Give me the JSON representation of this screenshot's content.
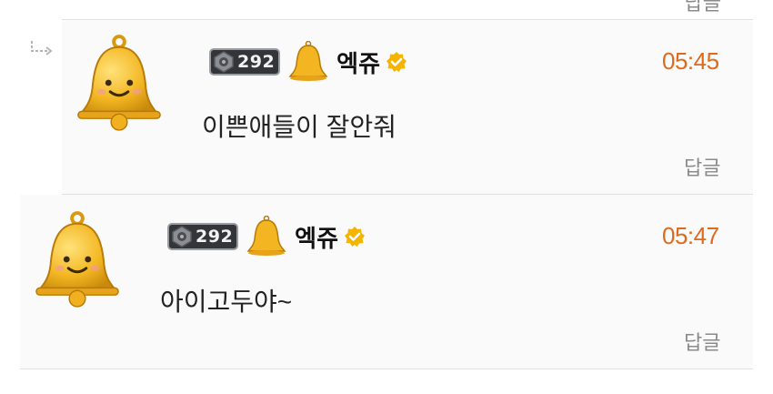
{
  "thread": {
    "prev_reply_label": "답글",
    "comments": [
      {
        "type": "reply",
        "level": "292",
        "nickname": "엑쥬",
        "time": "05:45",
        "text": "이쁜애들이 잘안줘",
        "reply_label": "답글"
      },
      {
        "type": "comment",
        "level": "292",
        "nickname": "엑쥬",
        "time": "05:47",
        "text": "아이고두야~",
        "reply_label": "답글"
      }
    ]
  },
  "colors": {
    "time": "#e06a1c",
    "verified": "#f5b400",
    "bell": "#f3b622",
    "badge_bg": "#333538"
  },
  "icons": {
    "reply_arrow": "reply-arrow-icon",
    "avatar": "bell-character-icon",
    "level_gem": "level-gem-icon",
    "grade": "bell-grade-icon",
    "verified": "verified-check-icon"
  }
}
